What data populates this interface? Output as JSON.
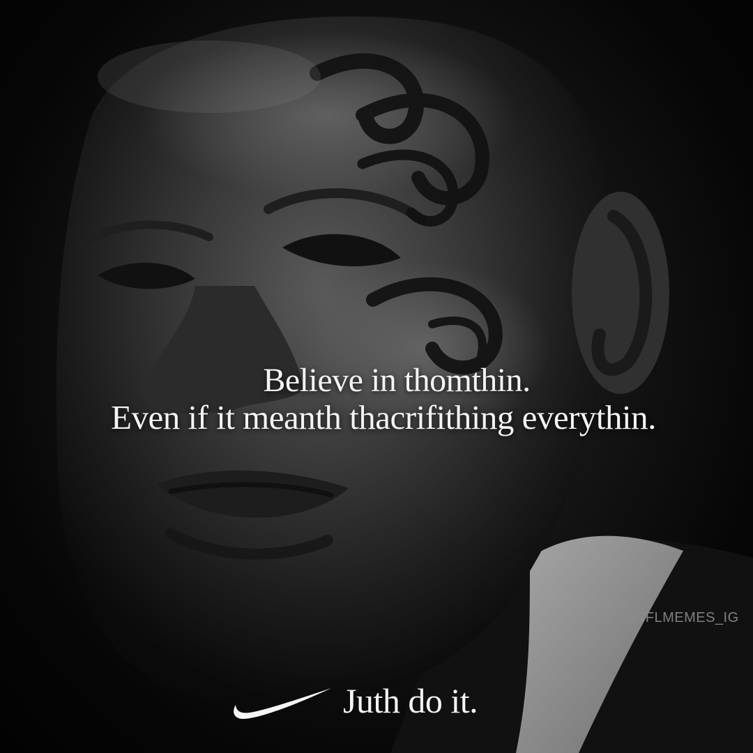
{
  "quote": {
    "line1": "Believe in thomthin.",
    "line2": "Even if  it meanth thacrifithing everythin."
  },
  "watermark": "@NFLMEMES_IG",
  "brand": {
    "logo_icon": "swoosh-icon",
    "slogan": "Juth do it."
  },
  "colors": {
    "background": "#050505",
    "text": "#f4f4f4",
    "watermark": "#8d8d8d"
  }
}
